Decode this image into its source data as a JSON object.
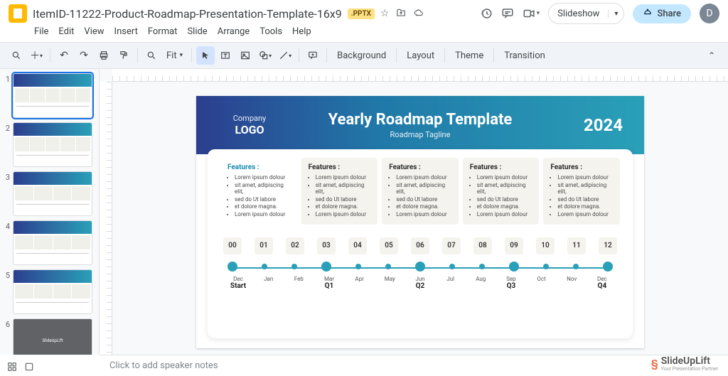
{
  "doc": {
    "title": "ItemID-11222-Product-Roadmap-Presentation-Template-16x9",
    "badge": ".PPTX"
  },
  "menus": [
    "File",
    "Edit",
    "View",
    "Insert",
    "Format",
    "Slide",
    "Arrange",
    "Tools",
    "Help"
  ],
  "header_right": {
    "slideshow": "Slideshow",
    "share": "Share",
    "avatar": "D"
  },
  "toolbar": {
    "zoom": "Fit",
    "background": "Background",
    "layout": "Layout",
    "theme": "Theme",
    "transition": "Transition"
  },
  "filmstrip": {
    "slides": [
      "1",
      "2",
      "3",
      "4",
      "5",
      "6"
    ],
    "logo_text": "SlideUpLift"
  },
  "slide": {
    "logo_top": "Company",
    "logo_bot": "LOGO",
    "title": "Yearly Roadmap Template",
    "subtitle": "Roadmap Tagline",
    "year": "2024",
    "feature_title": "Features :",
    "bullets": [
      "Lorem ipsum dolour",
      "sit amet, adipiscing elit,",
      "sed do Ut labore",
      "et dolore magna.",
      "Lorem ipsum dolour"
    ],
    "months_num": [
      "00",
      "01",
      "02",
      "03",
      "04",
      "05",
      "06",
      "07",
      "08",
      "09",
      "10",
      "11",
      "12"
    ],
    "months_abbr": [
      "Dec",
      "Jan",
      "Feb",
      "Mar",
      "Apr",
      "May",
      "Jun",
      "Jul",
      "Aug",
      "Sep",
      "Oct",
      "Nov",
      "Dec"
    ],
    "quarters": [
      "Start",
      "",
      "",
      "Q1",
      "",
      "",
      "Q2",
      "",
      "",
      "Q3",
      "",
      "",
      "Q4"
    ]
  },
  "notes": {
    "placeholder": "Click to add speaker notes"
  },
  "watermark": {
    "text": "SlideUpLift",
    "sub": "Your Presentation Partner"
  }
}
